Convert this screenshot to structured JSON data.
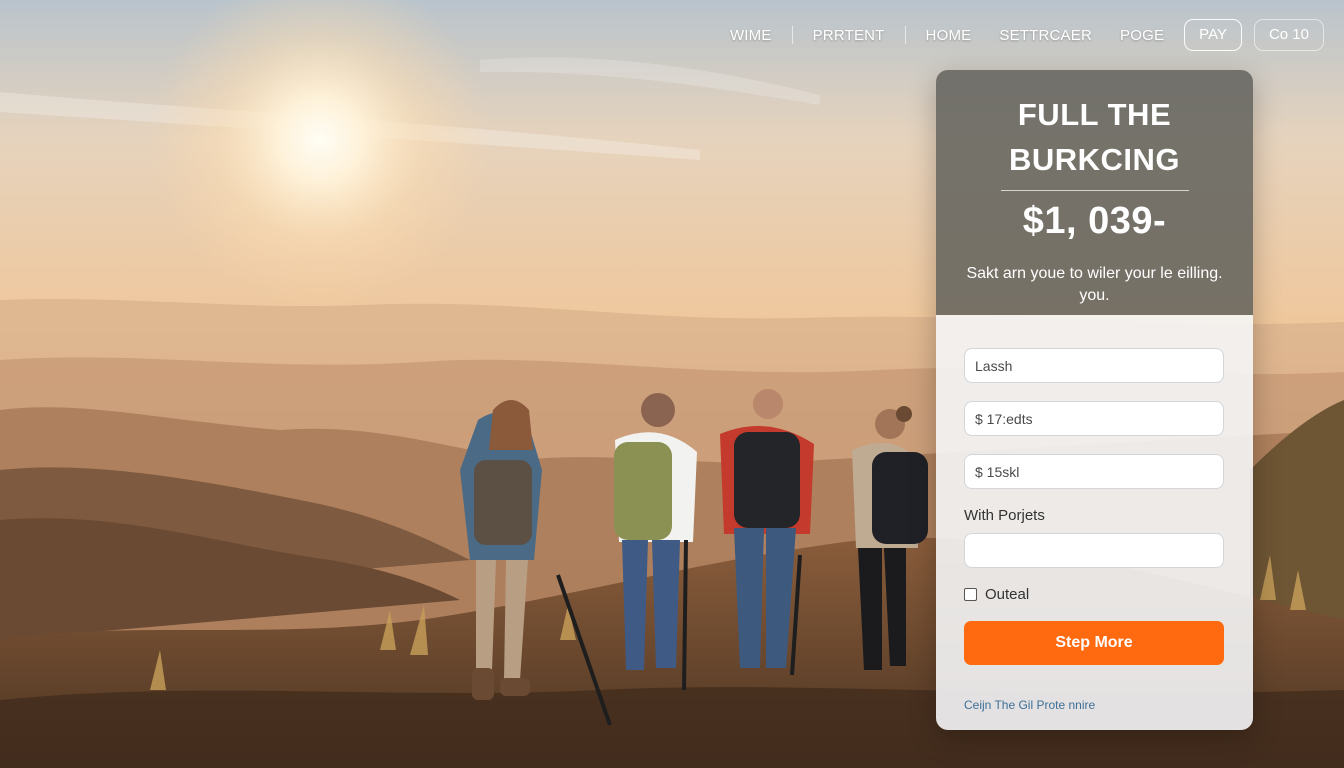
{
  "nav": {
    "links": [
      "WIME",
      "PRRTENT",
      "HOME",
      "SETTRCAER",
      "POGE"
    ],
    "pay_button": "PAY",
    "secondary_button": "Co 10"
  },
  "card": {
    "title_line1": "FULL THE",
    "title_line2": "BURKCING",
    "price": "$1, 039-",
    "subtitle_line1": "Sakt arn youe to wiler your le eilling.",
    "subtitle_line2": "you."
  },
  "form": {
    "field1_placeholder": "Lassh",
    "field2_placeholder": "$ 17:edts",
    "field3_placeholder": "$ 15skl",
    "label": "With Porjets",
    "field4_placeholder": "",
    "checkbox_label": "Outeal",
    "submit_label": "Step More",
    "footer_link": "Ceijn The Gil Prote nnire"
  },
  "colors": {
    "accent": "#ff6a10",
    "card_header": "#62625c",
    "link": "#3e6f97"
  }
}
